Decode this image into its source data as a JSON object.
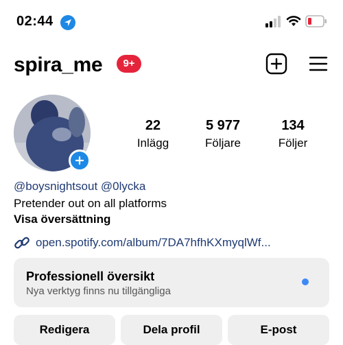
{
  "status_bar": {
    "time": "02:44"
  },
  "header": {
    "username": "spira_me",
    "notification_badge": "9+"
  },
  "stats": [
    {
      "number": "22",
      "label": "Inlägg"
    },
    {
      "number": "5 977",
      "label": "Följare"
    },
    {
      "number": "134",
      "label": "Följer"
    }
  ],
  "bio": {
    "mentions": "@boysnightsout @0lycka",
    "text": "Pretender out on all platforms",
    "translate": "Visa översättning",
    "link": "open.spotify.com/album/7DA7hfhKXmyqlWf..."
  },
  "professional_card": {
    "title": "Professionell översikt",
    "subtitle": "Nya verktyg finns nu tillgängliga"
  },
  "actions": {
    "edit": "Redigera",
    "share": "Dela profil",
    "email": "E-post"
  },
  "colors": {
    "accent_blue": "#1e88e5",
    "badge_red": "#e5243b",
    "link_blue": "#1f3a73"
  }
}
